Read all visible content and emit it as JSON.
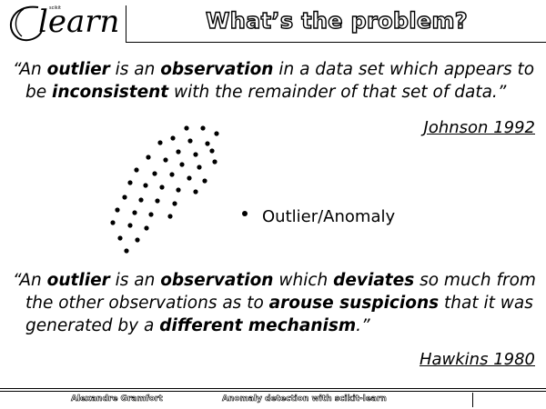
{
  "header": {
    "logo_text": "learn",
    "logo_small_text": "scikit",
    "title": "What’s the problem?"
  },
  "quote1": {
    "part1": "“An ",
    "bold1": "outlier",
    "part2": " is an ",
    "bold2": "observation",
    "part3": " in a data set which appears to",
    "part4": "be ",
    "bold3": "inconsistent",
    "part5": " with the remainder of that set of data.”",
    "citation": "Johnson 1992"
  },
  "legend": {
    "label": "Outlier/Anomaly"
  },
  "quote2": {
    "part1": "“An ",
    "bold1": "outlier",
    "part2": " is an ",
    "bold2": "observation",
    "part3": " which ",
    "bold3": "deviates",
    "part4": " so much from",
    "part5": "the other observations as to ",
    "bold4": "arouse suspicions",
    "part6": " that it was",
    "part7": "generated by a ",
    "bold5": "different mechanism",
    "part8": ".”",
    "citation": "Hawkins 1980"
  },
  "footer": {
    "author": "Alexandre Gramfort",
    "topic": "Anomaly detection with scikit-learn"
  }
}
